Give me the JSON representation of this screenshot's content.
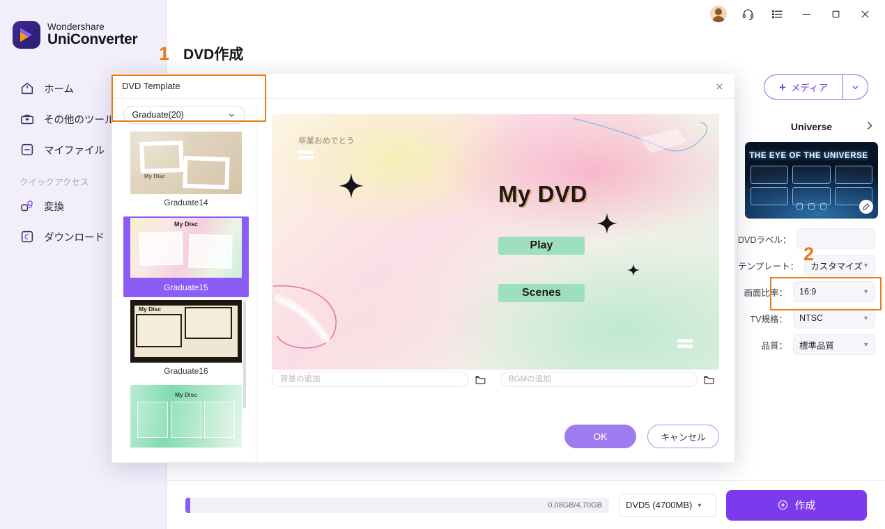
{
  "app": {
    "brand_top": "Wondershare",
    "brand_bottom": "UniConverter",
    "page_title": "DVD作成"
  },
  "titlebar": {
    "avatar": "avatar-icon",
    "headset": "headset-icon",
    "list": "list-icon",
    "minimize": "minimize-icon",
    "maximize": "maximize-icon",
    "close": "close-icon"
  },
  "sidebar": {
    "items": [
      {
        "label": "ホーム",
        "icon": "home-icon"
      },
      {
        "label": "その他のツール",
        "icon": "toolbox-icon"
      },
      {
        "label": "マイファイル",
        "icon": "file-icon"
      }
    ],
    "section_label": "クイックアクセス",
    "quick_items": [
      {
        "label": "変換",
        "icon": "convert-icon"
      },
      {
        "label": "ダウンロード",
        "icon": "download-icon"
      }
    ]
  },
  "toolbar": {
    "add_media_label": "メディア",
    "add_media_plus": "+",
    "caret": "chevron-down-icon"
  },
  "right_panel": {
    "title": "Universe",
    "chevron": "chevron-right-icon",
    "thumb_title": "THE EYE OF THE UNIVERSE",
    "edit_icon": "edit-icon",
    "fields": [
      {
        "label": "DVDラベル：",
        "value": "",
        "type": "input"
      },
      {
        "label": "テンプレート：",
        "value": "カスタマイズ",
        "type": "select"
      },
      {
        "label": "画面比率：",
        "value": "16:9",
        "type": "select"
      },
      {
        "label": "TV規格：",
        "value": "NTSC",
        "type": "select"
      },
      {
        "label": "品質：",
        "value": "標準品質",
        "type": "select"
      }
    ]
  },
  "bottombar": {
    "progress_text": "0.08GB/4.70GB",
    "progress_percent": 1.2,
    "disc_label": "DVD5 (4700MB)",
    "create_label": "作成",
    "create_icon": "disc-icon"
  },
  "dialog": {
    "title": "DVD Template",
    "close_icon": "close-icon",
    "template_select": {
      "value": "Graduate(20)",
      "caret": "chevron-down-icon"
    },
    "templates": [
      {
        "name": "Graduate14",
        "disc_label": "My Disc",
        "selected": false
      },
      {
        "name": "Graduate15",
        "disc_label": "My Disc",
        "selected": true
      },
      {
        "name": "Graduate16",
        "disc_label": "My Disc",
        "selected": false
      },
      {
        "name": "",
        "disc_label": "My Disc",
        "selected": false
      }
    ],
    "preview": {
      "greeting": "卒業おめでとう",
      "title": "My DVD",
      "play_label": "Play",
      "scenes_label": "Scenes"
    },
    "background_input": {
      "placeholder": "背景の追加",
      "value": ""
    },
    "bgm_input": {
      "placeholder": "BGMの追加",
      "value": ""
    },
    "folder_icon": "folder-icon",
    "ok_label": "OK",
    "cancel_label": "キャンセル"
  },
  "annotations": [
    {
      "number": "1"
    },
    {
      "number": "2"
    }
  ],
  "colors": {
    "accent": "#8b5cf6",
    "annotation": "#ec7a16",
    "sidebar_bg": "#f2effb"
  }
}
